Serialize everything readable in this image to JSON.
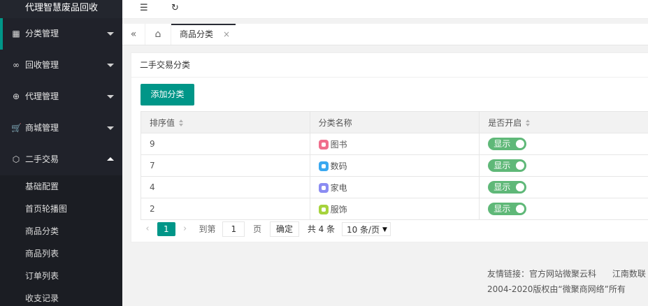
{
  "app": {
    "title": "代理智慧废品回收"
  },
  "sidebar": {
    "items": [
      {
        "label": "分类管理",
        "icon": "apps-icon",
        "glyph": "▦"
      },
      {
        "label": "回收管理",
        "icon": "link-icon",
        "glyph": "∞"
      },
      {
        "label": "代理管理",
        "icon": "add-circle-icon",
        "glyph": "⊕"
      },
      {
        "label": "商城管理",
        "icon": "cart-icon",
        "glyph": "🛒"
      },
      {
        "label": "二手交易",
        "icon": "cube-icon",
        "glyph": "⬡"
      }
    ],
    "subitems": [
      "基础配置",
      "首页轮播图",
      "商品分类",
      "商品列表",
      "订单列表",
      "收支记录"
    ]
  },
  "topbar": {
    "menu_glyph": "☰",
    "refresh_glyph": "↻"
  },
  "tabs": {
    "left_glyph": "«",
    "home_glyph": "⌂",
    "active_label": "商品分类",
    "close_glyph": "×"
  },
  "card": {
    "title": "二手交易分类",
    "add_button": "添加分类"
  },
  "table": {
    "headers": [
      "排序值",
      "分类名称",
      "是否开启"
    ],
    "rows": [
      {
        "sort": "9",
        "name": "图书",
        "icon_color": "#f06e8c",
        "status": "显示"
      },
      {
        "sort": "7",
        "name": "数码",
        "icon_color": "#3aa8f0",
        "status": "显示"
      },
      {
        "sort": "4",
        "name": "家电",
        "icon_color": "#8b8cf2",
        "status": "显示"
      },
      {
        "sort": "2",
        "name": "服饰",
        "icon_color": "#a6d33c",
        "status": "显示"
      }
    ]
  },
  "pager": {
    "prev": "‹",
    "next": "›",
    "current": "1",
    "goto_label": "到第",
    "goto_value": "1",
    "page_unit": "页",
    "confirm": "确定",
    "total": "共 4 条",
    "page_size": "10 条/页"
  },
  "footer": {
    "links": "友情链接：官方网站微聚云科      江南数联",
    "copyright": "2004-2020版权由“微聚商网络”所有"
  },
  "colors": {
    "accent": "#009688",
    "switch_on": "#5FB878",
    "sidebar_bg": "#20222a"
  }
}
